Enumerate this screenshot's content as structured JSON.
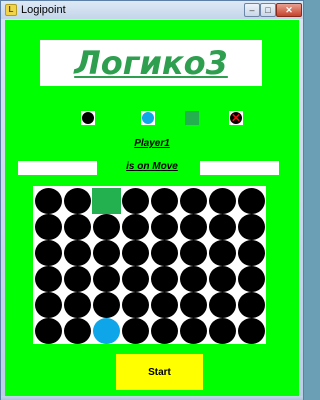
{
  "window": {
    "title": "Logipoint",
    "icon": "app-icon",
    "controls": {
      "minimize": "minimize-icon",
      "maximize": "maximize-icon",
      "close": "close-icon"
    },
    "minimize_glyph": "–",
    "maximize_glyph": "□",
    "close_glyph": "✕"
  },
  "logo": {
    "text": "Логико3"
  },
  "legend": [
    {
      "name": "black-piece",
      "color": "#000000"
    },
    {
      "name": "blue-piece",
      "color": "#0ea5e9"
    },
    {
      "name": "green-square",
      "color": "#23b04e"
    },
    {
      "name": "blocked-piece",
      "color": "#000000",
      "mark_color": "#e01010"
    }
  ],
  "status": {
    "player": "Player1",
    "move": "is on Move",
    "left_field_value": "",
    "right_field_value": ""
  },
  "board": {
    "rows": 6,
    "cols": 8,
    "cells": [
      [
        "black",
        "black",
        "green",
        "black",
        "black",
        "black",
        "black",
        "black"
      ],
      [
        "black",
        "black",
        "black",
        "black",
        "black",
        "black",
        "black",
        "black"
      ],
      [
        "black",
        "black",
        "black",
        "black",
        "black",
        "black",
        "black",
        "black"
      ],
      [
        "black",
        "black",
        "black",
        "black",
        "black",
        "black",
        "black",
        "black"
      ],
      [
        "black",
        "black",
        "black",
        "black",
        "black",
        "black",
        "black",
        "black"
      ],
      [
        "black",
        "black",
        "blue",
        "black",
        "black",
        "black",
        "black",
        "black"
      ]
    ]
  },
  "start_button": {
    "label": "Start"
  },
  "colors": {
    "background": "#00ff00",
    "logo_text": "#2e9e4f",
    "start_button": "#ffff00",
    "board_background": "#ffffff"
  }
}
